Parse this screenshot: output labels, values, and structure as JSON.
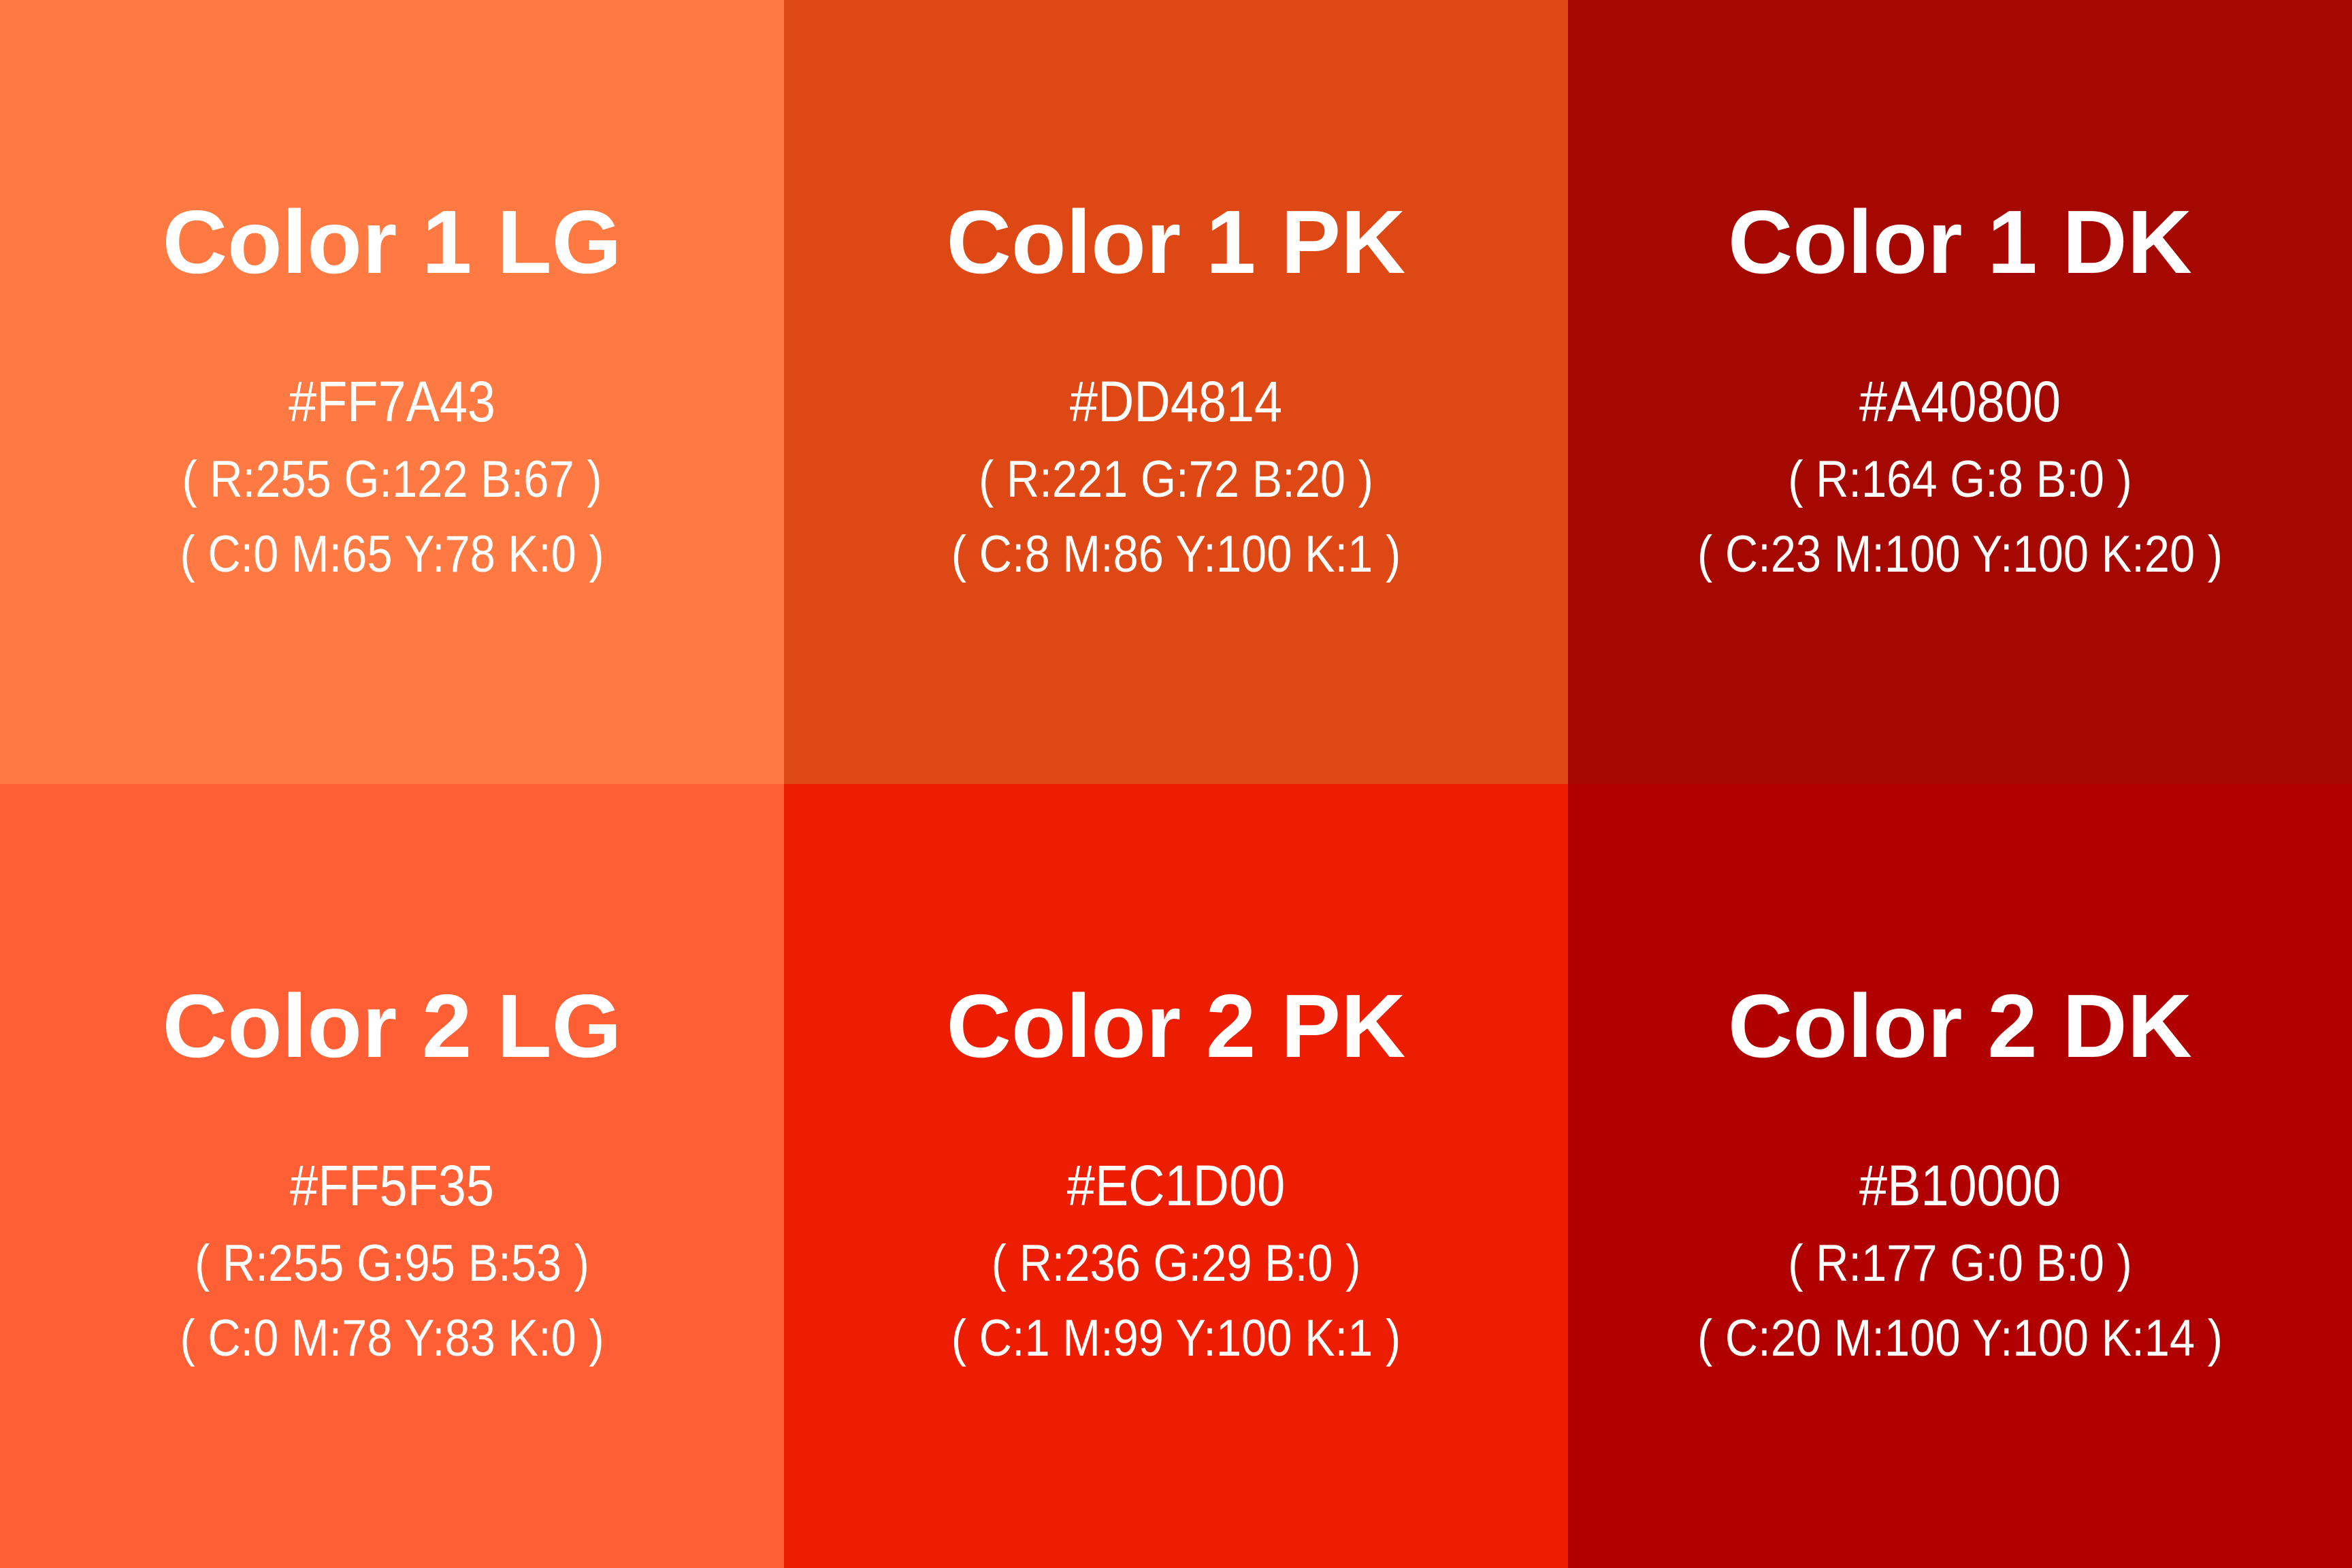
{
  "swatches": [
    {
      "title": "Color 1 LG",
      "hex": "#FF7A43",
      "rgb": "( R:255 G:122 B:67 )",
      "cmyk": "( C:0 M:65 Y:78 K:0 )",
      "background": "#FF7A43"
    },
    {
      "title": "Color 1 PK",
      "hex": "#DD4814",
      "rgb": "( R:221 G:72 B:20 )",
      "cmyk": "( C:8 M:86 Y:100 K:1 )",
      "background": "#DD4814"
    },
    {
      "title": "Color 1 DK",
      "hex": "#A40800",
      "rgb": "( R:164 G:8 B:0 )",
      "cmyk": "( C:23 M:100 Y:100 K:20 )",
      "background": "#A40800"
    },
    {
      "title": "Color 2 LG",
      "hex": "#FF5F35",
      "rgb": "( R:255 G:95 B:53 )",
      "cmyk": "( C:0 M:78 Y:83 K:0 )",
      "background": "#FF5F35"
    },
    {
      "title": "Color 2 PK",
      "hex": "#EC1D00",
      "rgb": "( R:236 G:29 B:0 )",
      "cmyk": "( C:1 M:99 Y:100 K:1 )",
      "background": "#EC1D00"
    },
    {
      "title": "Color 2 DK",
      "hex": "#B10000",
      "rgb": "( R:177 G:0 B:0 )",
      "cmyk": "( C:20 M:100 Y:100 K:14 )",
      "background": "#B10000"
    }
  ],
  "text_color": "#FFFFFF"
}
